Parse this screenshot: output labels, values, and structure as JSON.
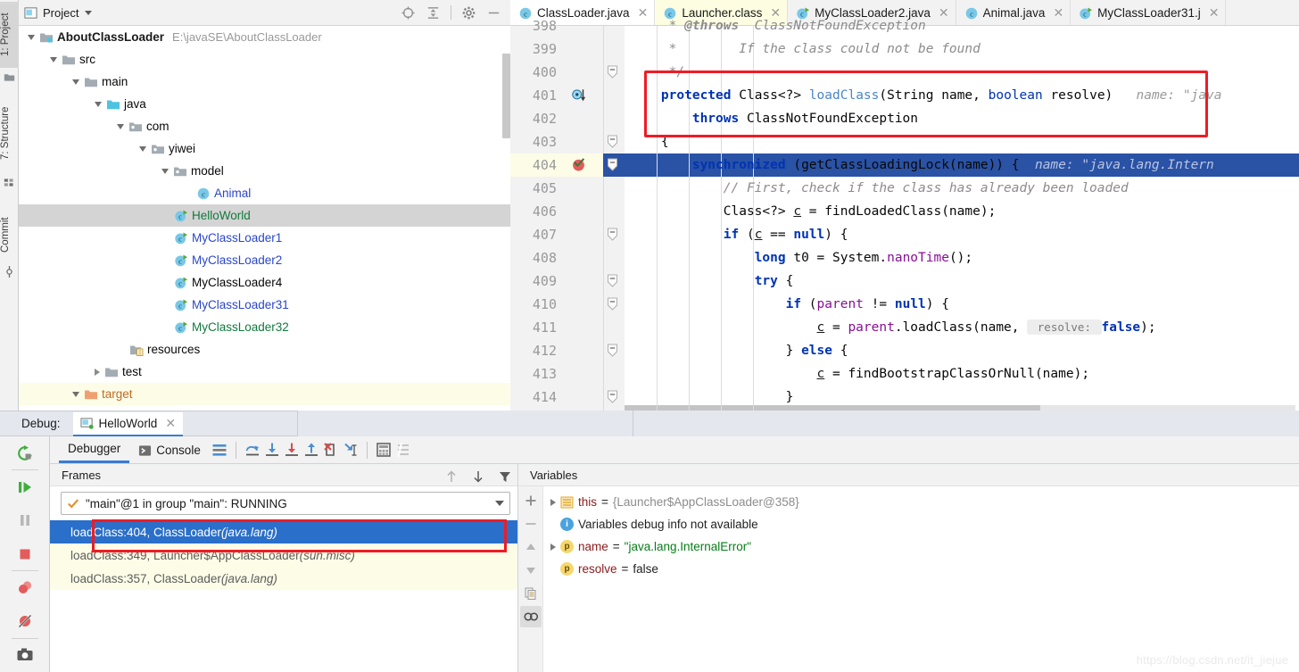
{
  "left_strip": {
    "tabs": [
      {
        "label": "1: Project",
        "icon": "project-folder-icon",
        "selected": true
      },
      {
        "label": "7: Structure",
        "icon": "structure-icon",
        "selected": false
      },
      {
        "label": "Commit",
        "icon": "commit-icon",
        "selected": false
      }
    ]
  },
  "project_panel": {
    "title": "Project",
    "tools": [
      "locate-icon",
      "collapse-all-icon",
      "gear-icon",
      "minimize-icon"
    ],
    "tree": [
      {
        "depth": 0,
        "arrow": "down",
        "icon": "module-icon",
        "label": "AboutClassLoader",
        "style": "bold",
        "path": "E:\\javaSE\\AboutClassLoader",
        "state": "normal"
      },
      {
        "depth": 1,
        "arrow": "down",
        "icon": "folder-icon",
        "label": "src",
        "style": "plain",
        "path": "",
        "state": "normal"
      },
      {
        "depth": 2,
        "arrow": "down",
        "icon": "folder-icon",
        "label": "main",
        "style": "plain",
        "path": "",
        "state": "normal"
      },
      {
        "depth": 3,
        "arrow": "down",
        "icon": "source-folder-icon",
        "label": "java",
        "style": "plain",
        "path": "",
        "state": "normal"
      },
      {
        "depth": 4,
        "arrow": "down",
        "icon": "package-icon",
        "label": "com",
        "style": "plain",
        "path": "",
        "state": "normal"
      },
      {
        "depth": 5,
        "arrow": "down",
        "icon": "package-icon",
        "label": "yiwei",
        "style": "plain",
        "path": "",
        "state": "normal"
      },
      {
        "depth": 6,
        "arrow": "down",
        "icon": "package-icon",
        "label": "model",
        "style": "plain",
        "path": "",
        "state": "normal"
      },
      {
        "depth": 7,
        "arrow": "none",
        "icon": "class-icon",
        "label": "Animal",
        "style": "blue",
        "path": "",
        "state": "normal"
      },
      {
        "depth": 6,
        "arrow": "none",
        "icon": "class-runnable-icon",
        "label": "HelloWorld",
        "style": "green",
        "path": "",
        "state": "selected"
      },
      {
        "depth": 6,
        "arrow": "none",
        "icon": "class-runnable-icon",
        "label": "MyClassLoader1",
        "style": "blue",
        "path": "",
        "state": "normal"
      },
      {
        "depth": 6,
        "arrow": "none",
        "icon": "class-runnable-icon",
        "label": "MyClassLoader2",
        "style": "blue",
        "path": "",
        "state": "normal"
      },
      {
        "depth": 6,
        "arrow": "none",
        "icon": "class-runnable-icon",
        "label": "MyClassLoader4",
        "style": "plain",
        "path": "",
        "state": "normal"
      },
      {
        "depth": 6,
        "arrow": "none",
        "icon": "class-runnable-icon",
        "label": "MyClassLoader31",
        "style": "blue",
        "path": "",
        "state": "normal"
      },
      {
        "depth": 6,
        "arrow": "none",
        "icon": "class-runnable-icon",
        "label": "MyClassLoader32",
        "style": "green",
        "path": "",
        "state": "normal"
      },
      {
        "depth": 4,
        "arrow": "none",
        "icon": "resources-folder-icon",
        "label": "resources",
        "style": "plain",
        "path": "",
        "state": "normal"
      },
      {
        "depth": 3,
        "arrow": "right",
        "icon": "folder-icon",
        "label": "test",
        "style": "plain",
        "path": "",
        "state": "normal"
      },
      {
        "depth": 2,
        "arrow": "down",
        "icon": "target-folder-icon",
        "label": "target",
        "style": "orange",
        "path": "",
        "state": "target"
      }
    ]
  },
  "editor": {
    "tabs": [
      {
        "label": "ClassLoader.java",
        "icon": "class-file-icon",
        "state": "active"
      },
      {
        "label": "Launcher.class",
        "icon": "class-file-icon",
        "state": "yellow"
      },
      {
        "label": "MyClassLoader2.java",
        "icon": "class-runnable-file-icon",
        "state": "normal"
      },
      {
        "label": "Animal.java",
        "icon": "class-file-icon",
        "state": "normal"
      },
      {
        "label": "MyClassLoader31.j",
        "icon": "class-runnable-file-icon",
        "state": "normal"
      }
    ],
    "lines": [
      {
        "num": "398",
        "clipped": true,
        "gutter": "",
        "fold": "",
        "current": false,
        "tokens": [
          {
            "t": "     * ",
            "c": "cmt"
          },
          {
            "t": "@throws",
            "c": "cmt-b"
          },
          {
            "t": "  ClassNotFoundException",
            "c": "cmt"
          }
        ]
      },
      {
        "num": "399",
        "gutter": "",
        "fold": "",
        "current": false,
        "tokens": [
          {
            "t": "     *        If the class could not be found",
            "c": "cmt"
          }
        ]
      },
      {
        "num": "400",
        "gutter": "",
        "fold": "minus",
        "current": false,
        "tokens": [
          {
            "t": "     */",
            "c": "cmt"
          }
        ]
      },
      {
        "num": "401",
        "gutter": "overridden-method-icon",
        "fold": "",
        "current": false,
        "tokens": [
          {
            "t": "    ",
            "c": "plain"
          },
          {
            "t": "protected",
            "c": "kw"
          },
          {
            "t": " Class<?> ",
            "c": "plain"
          },
          {
            "t": "loadClass",
            "c": "mth"
          },
          {
            "t": "(String name, ",
            "c": "plain"
          },
          {
            "t": "boolean",
            "c": "kw2"
          },
          {
            "t": " resolve) ",
            "c": "plain"
          },
          {
            "t": "  name: \"java",
            "c": "hint"
          }
        ]
      },
      {
        "num": "402",
        "gutter": "",
        "fold": "",
        "current": false,
        "tokens": [
          {
            "t": "        ",
            "c": "plain"
          },
          {
            "t": "throws",
            "c": "kw"
          },
          {
            "t": " ClassNotFoundException",
            "c": "plain"
          }
        ]
      },
      {
        "num": "403",
        "gutter": "",
        "fold": "minus",
        "current": false,
        "tokens": [
          {
            "t": "    {",
            "c": "plain"
          }
        ]
      },
      {
        "num": "404",
        "gutter": "breakpoint-hit-icon",
        "fold": "minus",
        "current": true,
        "tokens": [
          {
            "t": "        ",
            "c": "plain"
          },
          {
            "t": "synchronized",
            "c": "kw"
          },
          {
            "t": " (getClassLoadingLock(name)) {",
            "c": "plain"
          },
          {
            "t": "  name: \"java.lang.Intern",
            "c": "hint"
          }
        ]
      },
      {
        "num": "405",
        "gutter": "",
        "fold": "",
        "current": false,
        "tokens": [
          {
            "t": "            // First, check if the class has already been loaded",
            "c": "cmt"
          }
        ]
      },
      {
        "num": "406",
        "gutter": "",
        "fold": "",
        "current": false,
        "tokens": [
          {
            "t": "            Class<?> ",
            "c": "plain"
          },
          {
            "t": "c",
            "c": "uline"
          },
          {
            "t": " = findLoadedClass(name);",
            "c": "plain"
          }
        ]
      },
      {
        "num": "407",
        "gutter": "",
        "fold": "minus",
        "current": false,
        "tokens": [
          {
            "t": "            ",
            "c": "plain"
          },
          {
            "t": "if",
            "c": "kw"
          },
          {
            "t": " (",
            "c": "plain"
          },
          {
            "t": "c",
            "c": "uline"
          },
          {
            "t": " == ",
            "c": "plain"
          },
          {
            "t": "null",
            "c": "kw"
          },
          {
            "t": ") {",
            "c": "plain"
          }
        ]
      },
      {
        "num": "408",
        "gutter": "",
        "fold": "",
        "current": false,
        "tokens": [
          {
            "t": "                ",
            "c": "plain"
          },
          {
            "t": "long",
            "c": "kw"
          },
          {
            "t": " t0 = System.",
            "c": "plain"
          },
          {
            "t": "nanoTime",
            "c": "fld"
          },
          {
            "t": "();",
            "c": "plain"
          }
        ]
      },
      {
        "num": "409",
        "gutter": "",
        "fold": "minus",
        "current": false,
        "tokens": [
          {
            "t": "                ",
            "c": "plain"
          },
          {
            "t": "try",
            "c": "kw"
          },
          {
            "t": " {",
            "c": "plain"
          }
        ]
      },
      {
        "num": "410",
        "gutter": "",
        "fold": "minus",
        "current": false,
        "tokens": [
          {
            "t": "                    ",
            "c": "plain"
          },
          {
            "t": "if",
            "c": "kw"
          },
          {
            "t": " (",
            "c": "plain"
          },
          {
            "t": "parent",
            "c": "fld"
          },
          {
            "t": " != ",
            "c": "plain"
          },
          {
            "t": "null",
            "c": "kw"
          },
          {
            "t": ") {",
            "c": "plain"
          }
        ]
      },
      {
        "num": "411",
        "gutter": "",
        "fold": "",
        "current": false,
        "tokens": [
          {
            "t": "                        ",
            "c": "plain"
          },
          {
            "t": "c",
            "c": "uline"
          },
          {
            "t": " = ",
            "c": "plain"
          },
          {
            "t": "parent",
            "c": "fld"
          },
          {
            "t": ".loadClass(name, ",
            "c": "plain"
          },
          {
            "t": " resolve: ",
            "c": "hintbox"
          },
          {
            "t": "false",
            "c": "kw"
          },
          {
            "t": ");",
            "c": "plain"
          }
        ]
      },
      {
        "num": "412",
        "gutter": "",
        "fold": "minus",
        "current": false,
        "tokens": [
          {
            "t": "                    } ",
            "c": "plain"
          },
          {
            "t": "else",
            "c": "kw"
          },
          {
            "t": " {",
            "c": "plain"
          }
        ]
      },
      {
        "num": "413",
        "gutter": "",
        "fold": "",
        "current": false,
        "tokens": [
          {
            "t": "                        ",
            "c": "plain"
          },
          {
            "t": "c",
            "c": "uline"
          },
          {
            "t": " = findBootstrapClassOrNull(name);",
            "c": "plain"
          }
        ]
      },
      {
        "num": "414",
        "gutter": "",
        "fold": "minus",
        "current": false,
        "tokens": [
          {
            "t": "                    }",
            "c": "plain"
          }
        ]
      }
    ]
  },
  "debug": {
    "label": "Debug:",
    "run_config": "HelloWorld",
    "tabs": [
      {
        "label": "Debugger",
        "icon": "",
        "active": true
      },
      {
        "label": "Console",
        "icon": "console-icon",
        "active": false
      }
    ],
    "toolbar_icons": [
      "layout-icon",
      "step-over-icon",
      "step-into-icon",
      "force-step-into-icon",
      "step-out-icon",
      "drop-frame-icon",
      "run-to-cursor-icon",
      "evaluate-icon",
      "settings-list-icon"
    ],
    "rail_icons": [
      "rerun-icon",
      "resume-icon",
      "pause-icon",
      "stop-icon",
      "view-breakpoints-icon",
      "mute-breakpoints-icon",
      "screenshot-icon"
    ],
    "frames": {
      "header": "Frames",
      "thread": "\"main\"@1 in group \"main\": RUNNING",
      "nav_icons": [
        "arrow-up-icon",
        "arrow-down-icon",
        "filter-icon"
      ],
      "rows": [
        {
          "text": "loadClass:404, ClassLoader ",
          "pkg": "(java.lang)",
          "state": "selected"
        },
        {
          "text": "loadClass:349, Launcher$AppClassLoader ",
          "pkg": "(sun.misc)",
          "state": "dim"
        },
        {
          "text": "loadClass:357, ClassLoader ",
          "pkg": "(java.lang)",
          "state": "dim"
        }
      ]
    },
    "variables": {
      "header": "Variables",
      "rail_icons": [
        "plus-icon",
        "minus-icon",
        "up-icon",
        "down-icon",
        "copy-icon",
        "watches-icon"
      ],
      "rows": [
        {
          "expand": true,
          "badge": "list",
          "name": "this",
          "op": " = ",
          "value": "{Launcher$AppClassLoader@358}",
          "vclass": "vobj"
        },
        {
          "expand": false,
          "badge": "info",
          "name": "",
          "op": "",
          "value": "Variables debug info not available",
          "vclass": "vop"
        },
        {
          "expand": true,
          "badge": "p",
          "name": "name",
          "op": " = ",
          "value": "\"java.lang.InternalError\"",
          "vclass": "vstr"
        },
        {
          "expand": false,
          "badge": "p",
          "name": "resolve",
          "op": " = ",
          "value": "false",
          "vclass": "vbool"
        }
      ]
    }
  },
  "watermark": "https://blog.csdn.net/it_jiejue",
  "colors": {
    "accent_blue": "#2a6fc9",
    "highlight_line": "#2a52a5",
    "annotation_red": "#ee1c25",
    "tab_yellow": "#fdfde1"
  }
}
